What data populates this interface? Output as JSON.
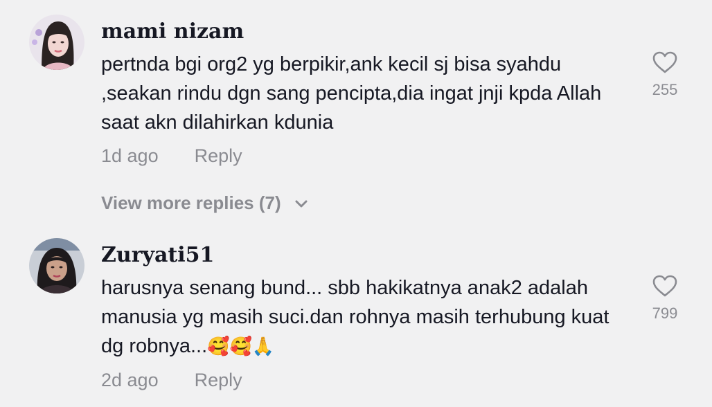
{
  "comments": [
    {
      "username": "mami nizam",
      "text": "pertnda bgi org2 yg berpikir,ank kecil sj bisa syahdu ,seakan rindu dgn sang pencipta,dia ingat jnji kpda Allah saat akn dilahirkan kdunia",
      "time": "1d ago",
      "reply_label": "Reply",
      "likes": "255",
      "view_more": "View more replies (7)"
    },
    {
      "username": "Zuryati51",
      "text": "harusnya senang bund... sbb hakikatnya anak2 adalah manusia yg masih suci.dan rohnya masih terhubung kuat dg robnya...",
      "emoji": "🥰🥰🙏",
      "time": "2d ago",
      "reply_label": "Reply",
      "likes": "799"
    }
  ],
  "colors": {
    "background": "#f1f1f2",
    "text": "#161823",
    "secondary": "#8a8b91"
  }
}
